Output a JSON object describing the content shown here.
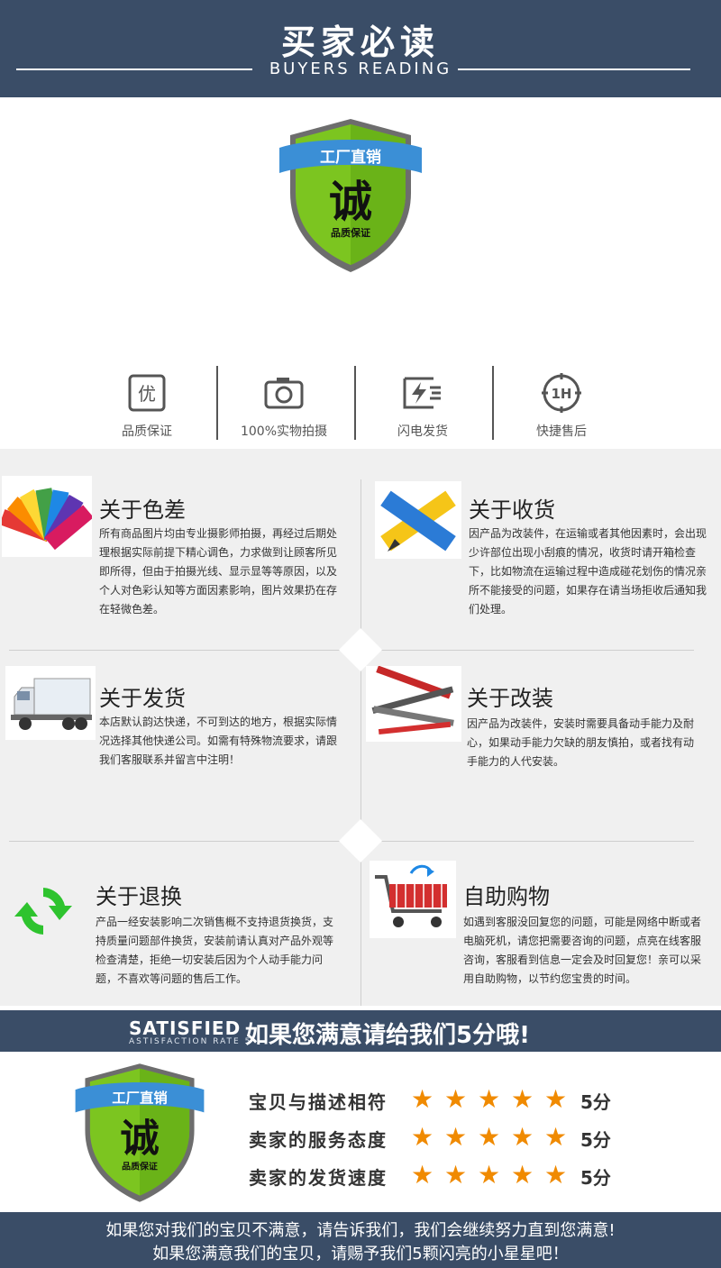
{
  "header": {
    "title": "买家必读",
    "subtitle": "BUYERS READING"
  },
  "shield": {
    "ribbon": "工厂直销",
    "big": "诚",
    "small": "品质保证"
  },
  "features": [
    {
      "icon": "quality-icon",
      "glyph": "优",
      "label": "品质保证"
    },
    {
      "icon": "camera-icon",
      "glyph": "",
      "label": "100%实物拍摄"
    },
    {
      "icon": "lightning-icon",
      "glyph": "",
      "label": "闪电发货"
    },
    {
      "icon": "clock-1h-icon",
      "glyph": "1H",
      "label": "快捷售后"
    }
  ],
  "sections": {
    "color": {
      "title": "关于色差",
      "text": "所有商品图片均由专业摄影师拍摄，再经过后期处理根据实际前提下精心调色，力求做到让顾客所见即所得，但由于拍摄光线、显示显等等原因，以及个人对色彩认知等方面因素影响，图片效果扔在存在轻微色差。"
    },
    "receive": {
      "title": "关于收货",
      "text": "因产品为改装件，在运输或者其他因素时，会出现少许部位出现小刮痕的情况，收货时请开箱检查下，比如物流在运输过程中造成碰花划伤的情况亲所不能接受的问题，如果存在请当场拒收后通知我们处理。"
    },
    "ship": {
      "title": "关于发货",
      "text": "本店默认韵达快递，不可到达的地方，根据实际情况选择其他快递公司。如需有特殊物流要求，请跟我们客服联系并留言中注明！"
    },
    "modify": {
      "title": "关于改装",
      "text": "因产品为改装件，安装时需要具备动手能力及耐心，如果动手能力欠缺的朋友慎拍，或者找有动手能力的人代安装。"
    },
    "return": {
      "title": "关于退换",
      "text": "产品一经安装影响二次销售概不支持退货换货，支持质量问题部件换货，安装前请认真对产品外观等检查清楚，拒绝一切安装后因为个人动手能力问题，不喜欢等问题的售后工作。"
    },
    "self": {
      "title": "自助购物",
      "text": "如遇到客服没回复您的问题，可能是网络中断或者电脑死机，请您把需要咨询的问题，点亮在线客服咨询，客服看到信息一定会及时回复您！亲可以采用自助购物，以节约您宝贵的时间。"
    }
  },
  "rating": {
    "en_title": "SATISFIED",
    "en_sub": "ASTISFACTION RATE 5",
    "cn_title": "如果您满意请给我们5分哦!",
    "rows": [
      {
        "label": "宝贝与描述相符",
        "stars": 5,
        "score": "5分"
      },
      {
        "label": "卖家的服务态度",
        "stars": 5,
        "score": "5分"
      },
      {
        "label": "卖家的发货速度",
        "stars": 5,
        "score": "5分"
      }
    ],
    "star_color": "#f08a00"
  },
  "footer": {
    "line1": "如果您对我们的宝贝不满意，请告诉我们，我们会继续努力直到您满意!",
    "line2": "如果您满意我们的宝贝，请赐予我们5颗闪亮的小星星吧！"
  },
  "colors": {
    "band": "#3a4d67",
    "shield_green": "#7cc520",
    "ribbon_blue": "#3b8fd6"
  }
}
